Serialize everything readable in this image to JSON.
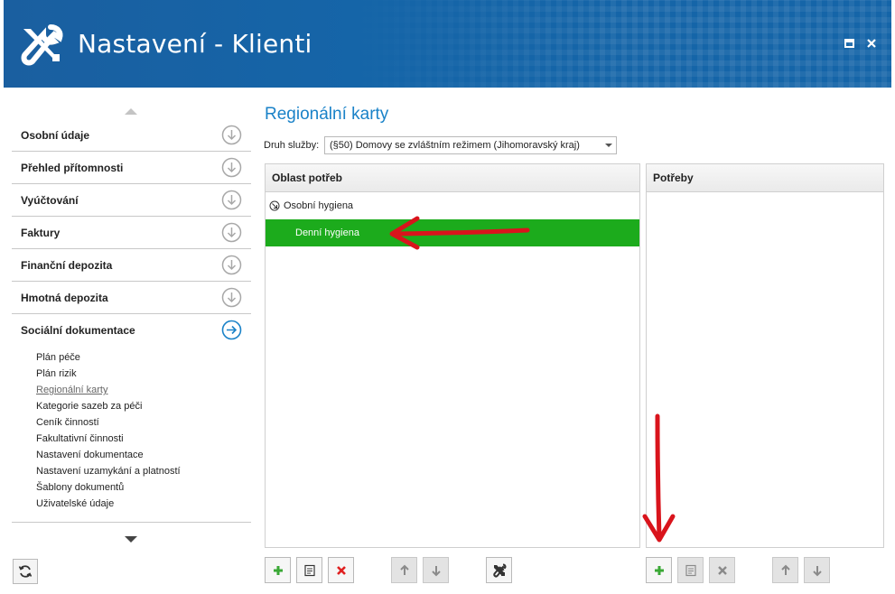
{
  "window": {
    "title": "Nastavení - Klienti",
    "accent": "#1565a8"
  },
  "sidebar": {
    "items": [
      {
        "label": "Osobní údaje",
        "icon": "chevron-down-circle-icon"
      },
      {
        "label": "Přehled přítomnosti",
        "icon": "chevron-down-circle-icon"
      },
      {
        "label": "Vyúčtování",
        "icon": "chevron-down-circle-icon"
      },
      {
        "label": "Faktury",
        "icon": "chevron-down-circle-icon"
      },
      {
        "label": "Finanční depozita",
        "icon": "chevron-down-circle-icon"
      },
      {
        "label": "Hmotná depozita",
        "icon": "chevron-down-circle-icon"
      },
      {
        "label": "Sociální dokumentace",
        "icon": "arrow-right-circle-icon"
      }
    ],
    "sub_items": [
      {
        "label": "Plán péče"
      },
      {
        "label": "Plán rizik"
      },
      {
        "label": "Regionální karty"
      },
      {
        "label": "Kategorie sazeb za péči"
      },
      {
        "label": "Ceník činností"
      },
      {
        "label": "Fakultativní činnosti"
      },
      {
        "label": "Nastavení dokumentace"
      },
      {
        "label": "Nastavení uzamykání a platností"
      },
      {
        "label": "Šablony dokumentů"
      },
      {
        "label": "Uživatelské údaje"
      }
    ],
    "active_sub_item": "Regionální karty"
  },
  "main": {
    "title": "Regionální karty",
    "service_label": "Druh služby:",
    "service_value": "(§50) Domovy se zvláštním režimem (Jihomoravský kraj)",
    "left_panel": {
      "header": "Oblast potřeb",
      "tree": {
        "parent": "Osobní hygiena",
        "selected_child": "Denní hygiena"
      },
      "selected_color": "#1cab1c"
    },
    "right_panel": {
      "header": "Potřeby"
    }
  },
  "toolbar": {
    "add_color": "#3aa835",
    "delete_color": "#e02020"
  }
}
